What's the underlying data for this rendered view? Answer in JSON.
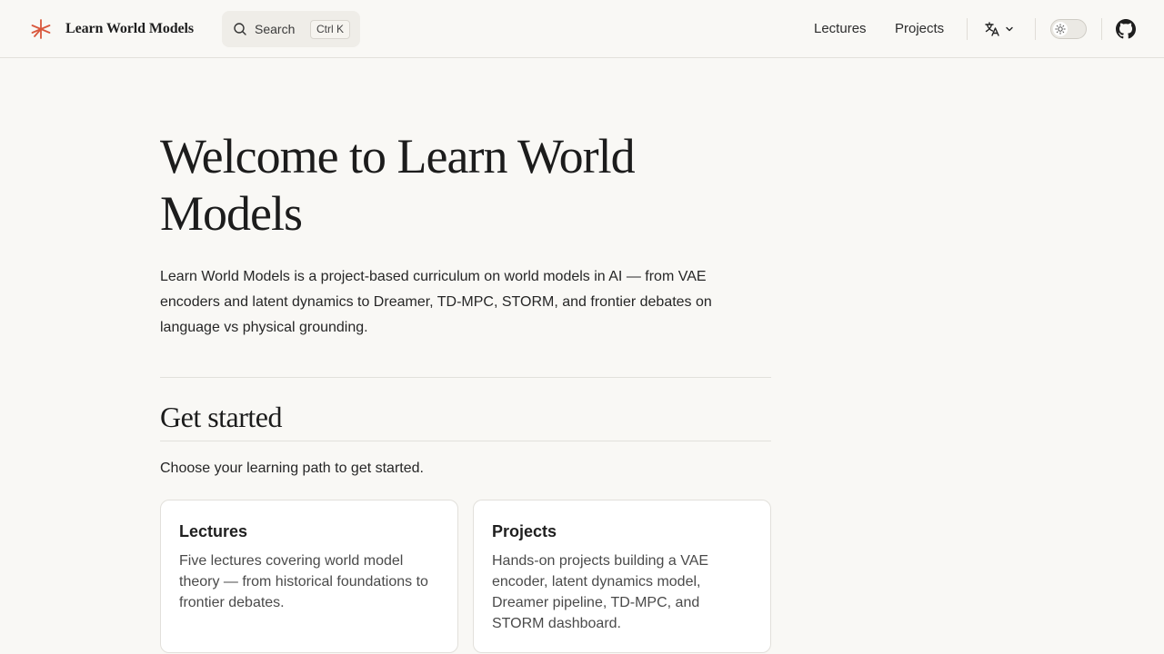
{
  "header": {
    "brand_title": "Learn World Models",
    "search_label": "Search",
    "search_shortcut": "Ctrl K",
    "nav": [
      {
        "label": "Lectures"
      },
      {
        "label": "Projects"
      }
    ],
    "icons": {
      "logo": "asterisk-logo-icon",
      "search": "search-icon",
      "language": "translate-icon",
      "theme": "sun-icon",
      "github": "github-icon"
    }
  },
  "main": {
    "title": "Welcome to Learn World Models",
    "intro": "Learn World Models is a project-based curriculum on world models in AI — from VAE encoders and latent dynamics to Dreamer, TD-MPC, STORM, and frontier debates on language vs physical grounding.",
    "section_title": "Get started",
    "section_subtitle": "Choose your learning path to get started.",
    "cards": [
      {
        "title": "Lectures",
        "description": "Five lectures covering world model theory — from historical foundations to frontier debates."
      },
      {
        "title": "Projects",
        "description": "Hands-on projects building a VAE encoder, latent dynamics model, Dreamer pipeline, TD-MPC, and STORM dashboard."
      }
    ]
  },
  "colors": {
    "background": "#f9f8f5",
    "accent": "#d9573c",
    "text": "#1f1f1f"
  }
}
